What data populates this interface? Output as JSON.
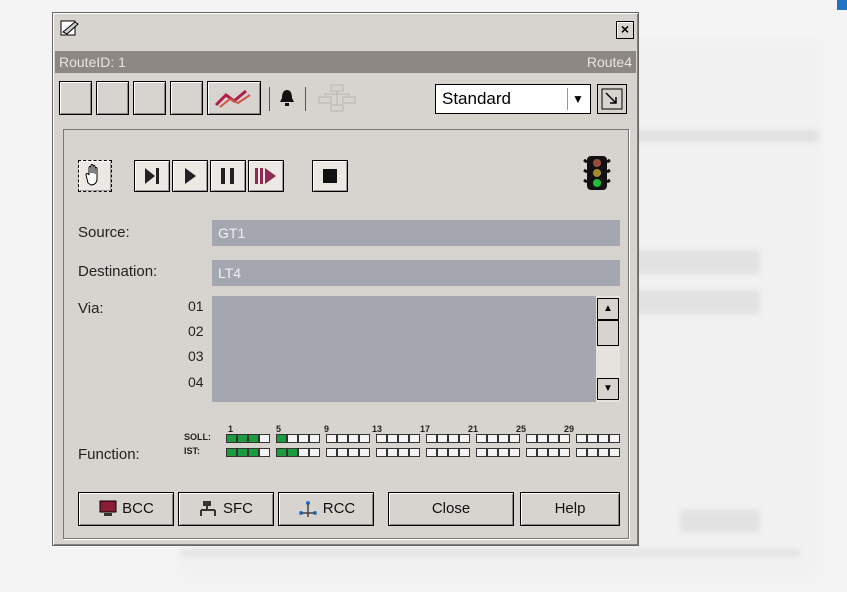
{
  "window": {
    "close_label": "×"
  },
  "route_bar": {
    "left": "RouteID: 1",
    "right": "Route4"
  },
  "toolbar": {
    "mode_select": "Standard",
    "select_arrow": "▼"
  },
  "fields": {
    "source_label": "Source:",
    "source_value": "GT1",
    "destination_label": "Destination:",
    "destination_value": "LT4",
    "via_label": "Via:",
    "via_numbers": [
      "01",
      "02",
      "03",
      "04"
    ]
  },
  "function": {
    "label": "Function:",
    "soll_label": "SOLL:",
    "ist_label": "IST:",
    "numbers": [
      "1",
      "5",
      "9",
      "13",
      "17",
      "21",
      "25",
      "29"
    ]
  },
  "buttons": {
    "bcc": "BCC",
    "sfc": "SFC",
    "rcc": "RCC",
    "close": "Close",
    "help": "Help"
  },
  "colors": {
    "route_bar": "#8d8884",
    "field": "#a5a7b0",
    "active_bit": "#1a9c3e",
    "dialog_face": "#d7d3ce"
  }
}
